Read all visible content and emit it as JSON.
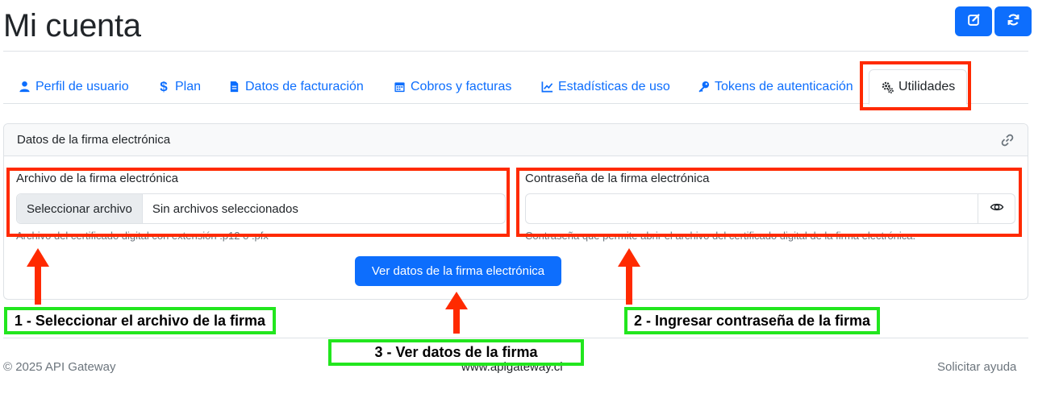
{
  "header": {
    "title": "Mi cuenta",
    "edit_icon": "edit-icon",
    "refresh_icon": "refresh-icon"
  },
  "tabs": [
    {
      "label": "Perfil de usuario",
      "icon": "user-icon"
    },
    {
      "label": "Plan",
      "icon": "dollar-icon"
    },
    {
      "label": "Datos de facturación",
      "icon": "file-invoice-icon"
    },
    {
      "label": "Cobros y facturas",
      "icon": "calendar-icon"
    },
    {
      "label": "Estadísticas de uso",
      "icon": "chart-line-icon"
    },
    {
      "label": "Tokens de autenticación",
      "icon": "key-icon"
    },
    {
      "label": "Utilidades",
      "icon": "cogs-icon",
      "active": true
    }
  ],
  "card": {
    "title": "Datos de la firma electrónica",
    "file": {
      "label": "Archivo de la firma electrónica",
      "button": "Seleccionar archivo",
      "value": "Sin archivos seleccionados",
      "help": "Archivo del certificado digital con extensión .p12 o .pfx"
    },
    "password": {
      "label": "Contraseña de la firma electrónica",
      "value": "",
      "help": "Contraseña que permite abrir el archivo del certificado digital de la firma electrónica."
    },
    "submit": "Ver datos de la firma electrónica"
  },
  "annotations": {
    "step1": "1 - Seleccionar el archivo de la firma",
    "step2": "2 - Ingresar contraseña de la firma",
    "step3": "3 - Ver datos de la firma"
  },
  "footer": {
    "copyright": "© 2025 API Gateway",
    "site": "www.apigateway.cl",
    "help": "Solicitar ayuda"
  },
  "colors": {
    "primary": "#0d6efd",
    "annotation_red": "#ff2a00",
    "annotation_green": "#22e61e"
  }
}
